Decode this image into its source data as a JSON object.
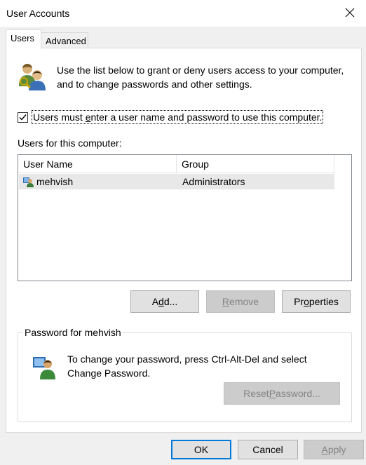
{
  "window": {
    "title": "User Accounts"
  },
  "tabs": [
    {
      "label": "Users",
      "active": true
    },
    {
      "label": "Advanced",
      "active": false
    }
  ],
  "intro": {
    "text": "Use the list below to grant or deny users access to your computer, and to change passwords and other settings."
  },
  "must_logon": {
    "checked": true,
    "label_pre": "Users must ",
    "label_accel": "e",
    "label_post": "nter a user name and password to use this computer."
  },
  "users_label": "Users for this computer:",
  "list": {
    "columns": [
      "User Name",
      "Group"
    ],
    "rows": [
      {
        "name": "mehvish",
        "group": "Administrators"
      }
    ]
  },
  "buttons": {
    "add": {
      "pre": "A",
      "accel": "d",
      "post": "d..."
    },
    "remove": {
      "pre": "",
      "accel": "R",
      "post": "emove"
    },
    "properties": {
      "pre": "Pr",
      "accel": "o",
      "post": "perties"
    },
    "reset_password": {
      "pre": "Reset ",
      "accel": "P",
      "post": "assword..."
    },
    "ok": "OK",
    "cancel": "Cancel",
    "apply": {
      "pre": "",
      "accel": "A",
      "post": "pply"
    }
  },
  "password_group": {
    "title": "Password for mehvish",
    "text": "To change your password, press Ctrl-Alt-Del and select Change Password."
  },
  "colors": {
    "focus_border": "#0078d7",
    "selected_row": "#e8e8e8"
  }
}
